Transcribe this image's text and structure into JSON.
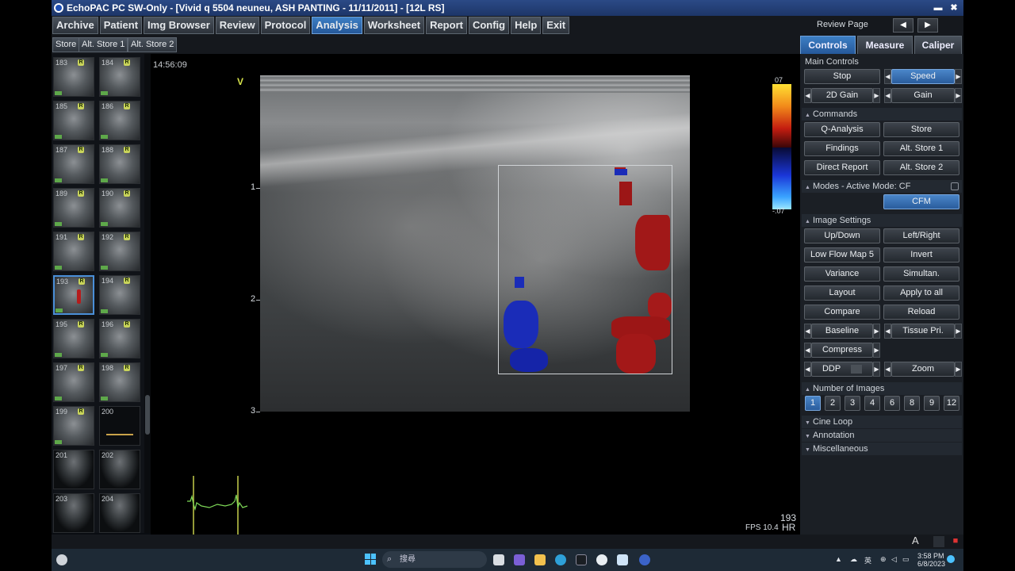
{
  "window": {
    "title": "EchoPAC PC SW-Only - [Vivid q 5504 neuneu, ASH PANTING - 11/11/2011] - [12L RS]",
    "minimize": "▬",
    "close": "✖"
  },
  "menu": {
    "items": [
      "Archive",
      "Patient",
      "Img Browser",
      "Review",
      "Protocol",
      "Analysis",
      "Worksheet",
      "Report",
      "Config",
      "Help",
      "Exit"
    ],
    "active": "Analysis",
    "review_page_label": "Review Page",
    "prev": "◀",
    "next": "▶"
  },
  "store_bar": {
    "store": "Store",
    "alt_store_1": "Alt. Store 1",
    "alt_store_2": "Alt. Store 2"
  },
  "tabs": {
    "controls": "Controls",
    "measure": "Measure",
    "caliper": "Caliper",
    "active": "Controls"
  },
  "thumbnails": [
    {
      "num": "183",
      "kind": "bmode"
    },
    {
      "num": "184",
      "kind": "bmode"
    },
    {
      "num": "185",
      "kind": "bmode"
    },
    {
      "num": "186",
      "kind": "bmode"
    },
    {
      "num": "187",
      "kind": "bmode"
    },
    {
      "num": "188",
      "kind": "bmode"
    },
    {
      "num": "189",
      "kind": "bmode"
    },
    {
      "num": "190",
      "kind": "bmode"
    },
    {
      "num": "191",
      "kind": "bmode"
    },
    {
      "num": "192",
      "kind": "bmode"
    },
    {
      "num": "193",
      "kind": "color",
      "selected": true
    },
    {
      "num": "194",
      "kind": "bmode"
    },
    {
      "num": "195",
      "kind": "bmode"
    },
    {
      "num": "196",
      "kind": "bmode"
    },
    {
      "num": "197",
      "kind": "bmode"
    },
    {
      "num": "198",
      "kind": "bmode"
    },
    {
      "num": "199",
      "kind": "bmode"
    },
    {
      "num": "200",
      "kind": "doppler"
    },
    {
      "num": "201",
      "kind": "fan"
    },
    {
      "num": "202",
      "kind": "fan"
    },
    {
      "num": "203",
      "kind": "fan"
    },
    {
      "num": "204",
      "kind": "fan"
    }
  ],
  "image": {
    "timestamp": "14:56:09",
    "orientation_marker": "V",
    "depth_labels": [
      "1",
      "2",
      "3"
    ],
    "colorbar_top": "07",
    "colorbar_bottom": "-.07",
    "frame_number": "193",
    "fps": "FPS 10.4",
    "hr": "HR"
  },
  "panel": {
    "main_controls": "Main Controls",
    "stop": "Stop",
    "speed": "Speed",
    "gain_2d": "2D Gain",
    "gain": "Gain",
    "commands": "Commands",
    "q_analysis": "Q-Analysis",
    "store": "Store",
    "findings": "Findings",
    "alt_store_1": "Alt. Store 1",
    "direct_report": "Direct Report",
    "alt_store_2": "Alt. Store 2",
    "modes": "Modes - Active Mode: CF",
    "cfm": "CFM",
    "image_settings": "Image Settings",
    "up_down": "Up/Down",
    "left_right": "Left/Right",
    "low_flow_map": "Low Flow Map 5",
    "invert": "Invert",
    "variance": "Variance",
    "simultan": "Simultan.",
    "layout": "Layout",
    "apply_to_all": "Apply to all",
    "compare": "Compare",
    "reload": "Reload",
    "baseline": "Baseline",
    "tissue_pri": "Tissue Pri.",
    "compress": "Compress",
    "ddp": "DDP",
    "zoom": "Zoom",
    "number_of_images": "Number of Images",
    "image_counts": [
      "1",
      "2",
      "3",
      "4",
      "6",
      "8",
      "9",
      "12"
    ],
    "image_count_selected": "1",
    "cine_loop": "Cine Loop",
    "annotation": "Annotation",
    "miscellaneous": "Miscellaneous"
  },
  "statusbar": {
    "a_label": "A"
  },
  "taskbar": {
    "search_placeholder": "搜尋",
    "lang": "英",
    "time": "3:58 PM",
    "date": "6/8/2023"
  },
  "colors": {
    "accent_blue": "#2a5c9c",
    "doppler_red": "#b51c1c",
    "doppler_blue": "#1a2cb8",
    "ecg_green": "#7ed957"
  }
}
